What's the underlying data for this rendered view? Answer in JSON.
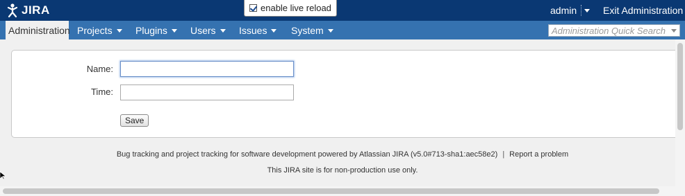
{
  "header": {
    "logo_text": "JIRA",
    "live_reload_label": "enable live reload",
    "live_reload_checked": true,
    "username": "admin",
    "exit_admin_label": "Exit Administration"
  },
  "nav": {
    "items": [
      {
        "label": "Administration",
        "active": true
      },
      {
        "label": "Projects"
      },
      {
        "label": "Plugins"
      },
      {
        "label": "Users"
      },
      {
        "label": "Issues"
      },
      {
        "label": "System"
      }
    ],
    "quick_search_placeholder": "Administration Quick Search"
  },
  "form": {
    "name_label": "Name:",
    "name_value": "",
    "time_label": "Time:",
    "time_value": "",
    "save_label": "Save"
  },
  "footer": {
    "powered_by": "Bug tracking and project tracking for software development powered by Atlassian JIRA (v5.0#713-sha1:aec58e2)",
    "separator": "|",
    "report_problem": "Report a problem",
    "non_production": "This JIRA site is for non-production use only."
  },
  "colors": {
    "header_bg": "#0a3873",
    "nav_bg": "#3572b0",
    "page_bg": "#f0f0f0"
  }
}
